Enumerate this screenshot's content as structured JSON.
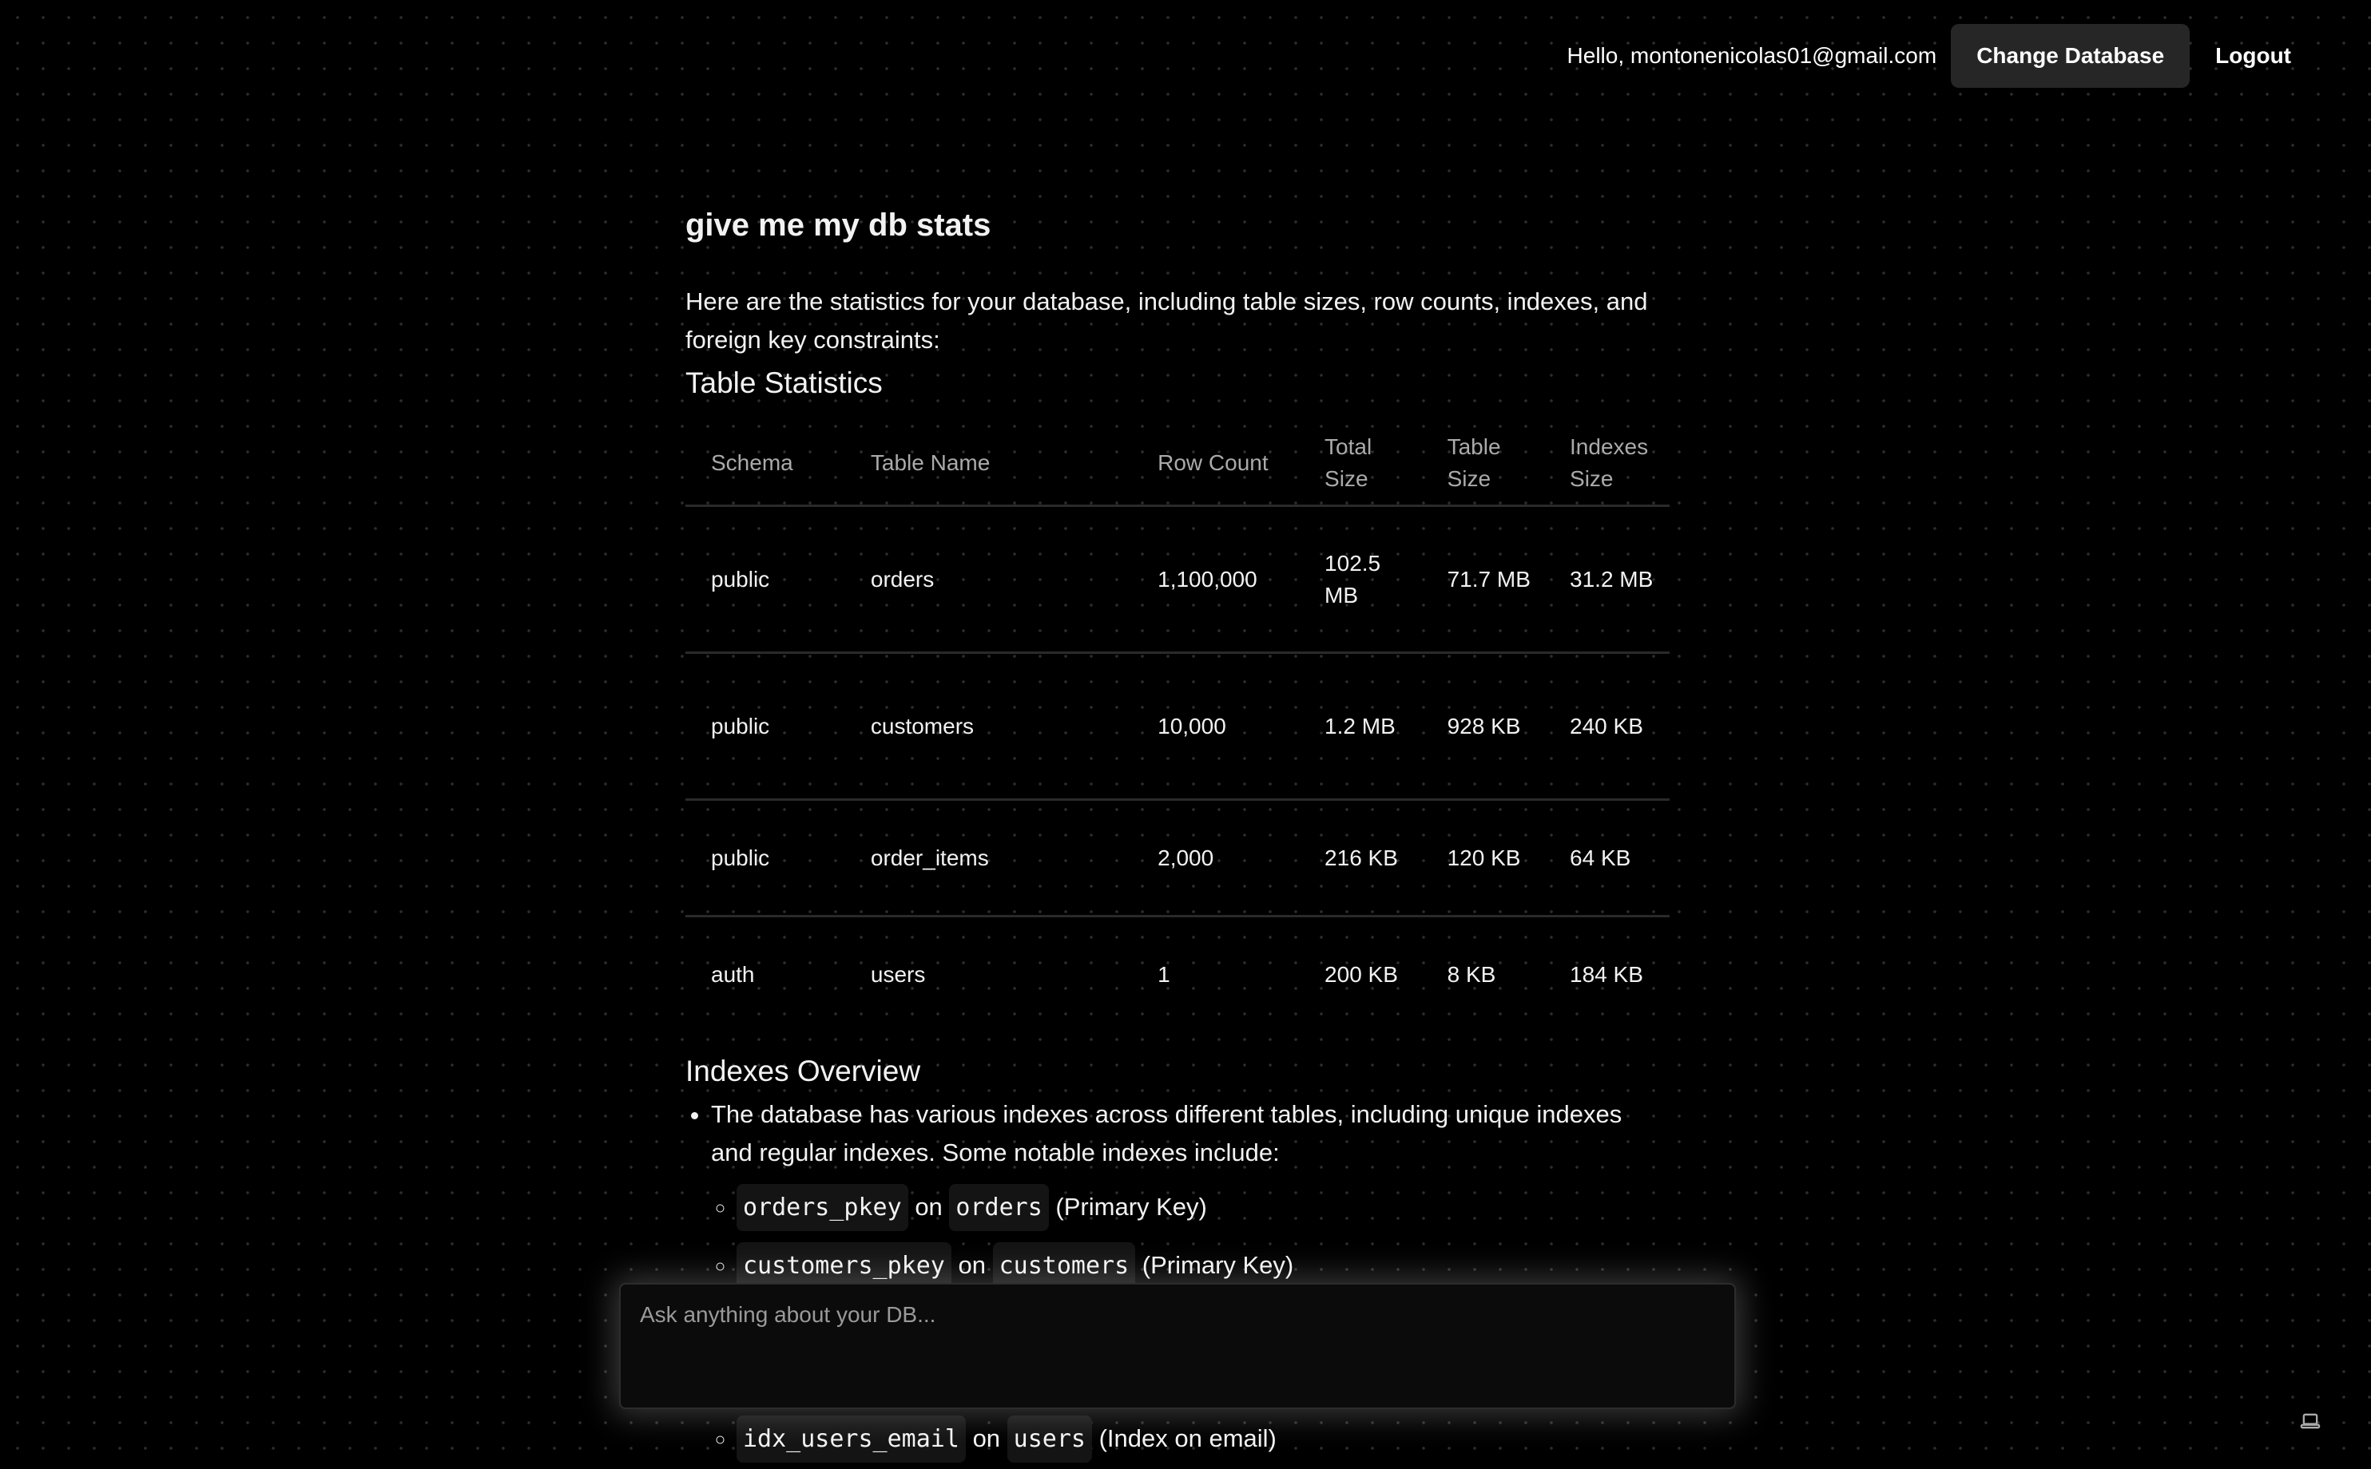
{
  "header": {
    "greeting": "Hello, montonenicolas01@gmail.com",
    "change_db_label": "Change Database",
    "logout_label": "Logout"
  },
  "chat": {
    "user_message": "give me my db stats",
    "intro": "Here are the statistics for your database, including table sizes, row counts, indexes, and foreign key constraints:",
    "table_heading": "Table Statistics",
    "table": {
      "columns": [
        "Schema",
        "Table Name",
        "Row Count",
        "Total Size",
        "Table Size",
        "Indexes Size"
      ],
      "rows": [
        [
          "public",
          "orders",
          "1,100,000",
          "102.5 MB",
          "71.7 MB",
          "31.2 MB"
        ],
        [
          "public",
          "customers",
          "10,000",
          "1.2 MB",
          "928 KB",
          "240 KB"
        ],
        [
          "public",
          "order_items",
          "2,000",
          "216 KB",
          "120 KB",
          "64 KB"
        ],
        [
          "auth",
          "users",
          "1",
          "200 KB",
          "8 KB",
          "184 KB"
        ]
      ]
    },
    "indexes_heading": "Indexes Overview",
    "indexes_intro": "The database has various indexes across different tables, including unique indexes and regular indexes. Some notable indexes include:",
    "indexes": [
      {
        "name": "orders_pkey",
        "on": "on",
        "table": "orders",
        "note": "(Primary Key)"
      },
      {
        "name": "customers_pkey",
        "on": "on",
        "table": "customers",
        "note": "(Primary Key)"
      },
      {
        "name": "",
        "on": "",
        "table": "",
        "note": ""
      },
      {
        "name": "",
        "on": "",
        "table": "",
        "note": ""
      },
      {
        "name": "idx_users_email",
        "on": "on",
        "table": "users",
        "note": "(Index on email)"
      }
    ]
  },
  "input": {
    "placeholder": "Ask anything about your DB...",
    "value": ""
  },
  "icons": {
    "bottom_right": "laptop-icon"
  }
}
